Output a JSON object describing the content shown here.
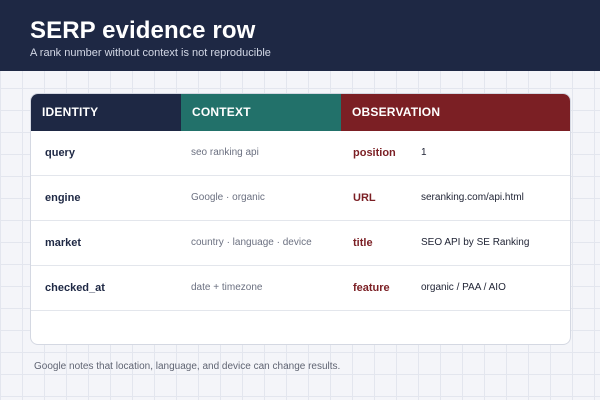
{
  "header": {
    "title": "SERP evidence row",
    "subtitle": "A rank number without context is not reproducible"
  },
  "columns": {
    "identity": "IDENTITY",
    "context": "CONTEXT",
    "observation": "OBSERVATION"
  },
  "rows": [
    {
      "identity": "query",
      "context": "seo ranking api",
      "obs_label": "position",
      "obs_value": "1"
    },
    {
      "identity": "engine",
      "context": "Google · organic",
      "obs_label": "URL",
      "obs_value": "seranking.com/api.html"
    },
    {
      "identity": "market",
      "context": "country · language · device",
      "obs_label": "title",
      "obs_value": "SEO API by SE Ranking"
    },
    {
      "identity": "checked_at",
      "context": "date + timezone",
      "obs_label": "feature",
      "obs_value": "organic / PAA / AIO"
    }
  ],
  "footnote": "Google notes that location, language, and device can change results.",
  "colors": {
    "navy": "#1e2844",
    "teal": "#22716a",
    "maroon": "#7b1f24"
  }
}
